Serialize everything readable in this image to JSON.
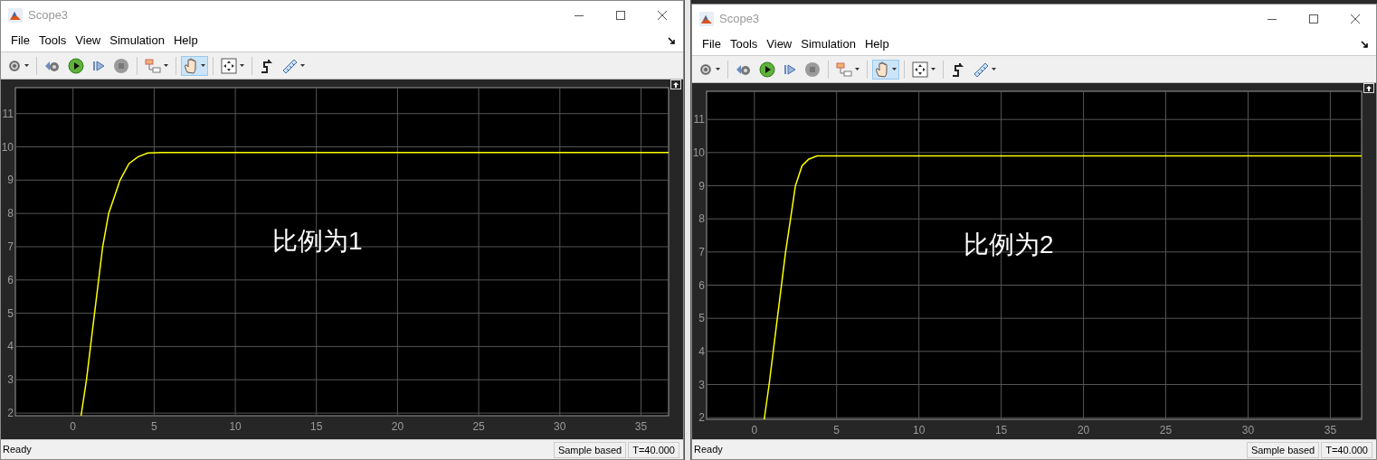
{
  "windows": [
    {
      "title": "Scope3",
      "menu": [
        {
          "label": "File"
        },
        {
          "label": "Tools"
        },
        {
          "label": "View"
        },
        {
          "label": "Simulation"
        },
        {
          "label": "Help"
        }
      ],
      "toolbar": {
        "pan_selected": true
      },
      "plot": {
        "overlay_text": "比例为1",
        "chart_data": {
          "type": "line",
          "grid": true,
          "x": [
            0.5,
            0.83,
            1.33,
            1.83,
            2.2,
            2.9,
            3.45,
            4.0,
            4.6,
            5.5,
            36.7
          ],
          "series": [
            {
              "color": "#ffff00",
              "values": [
                1.92,
                3,
                5,
                7,
                8,
                9,
                9.5,
                9.7,
                9.82,
                9.83,
                9.83
              ]
            }
          ],
          "xlim": [
            -3.55,
            36.7
          ],
          "ylim": [
            1.92,
            11.78
          ],
          "xticks": [
            0,
            5,
            10,
            15,
            20,
            25,
            30,
            35
          ],
          "yticks": [
            2,
            3,
            4,
            5,
            6,
            7,
            8,
            9,
            10,
            11
          ]
        }
      },
      "status": {
        "message": "Ready",
        "mode": "Sample based",
        "time": "T=40.000"
      }
    },
    {
      "title": "Scope3",
      "menu": [
        {
          "label": "File"
        },
        {
          "label": "Tools"
        },
        {
          "label": "View"
        },
        {
          "label": "Simulation"
        },
        {
          "label": "Help"
        }
      ],
      "toolbar": {
        "pan_selected": true
      },
      "plot": {
        "overlay_text": "比例为2",
        "chart_data": {
          "type": "line",
          "grid": true,
          "x": [
            0.6,
            0.9,
            1.4,
            1.9,
            2.2,
            2.5,
            2.9,
            3.3,
            3.8,
            36.9
          ],
          "series": [
            {
              "color": "#ffff00",
              "values": [
                1.95,
                3,
                5,
                7,
                8,
                9,
                9.6,
                9.8,
                9.9,
                9.9
              ]
            }
          ],
          "xlim": [
            -2.9,
            36.9
          ],
          "ylim": [
            1.95,
            11.85
          ],
          "xticks": [
            0,
            5,
            10,
            15,
            20,
            25,
            30,
            35
          ],
          "yticks": [
            2,
            3,
            4,
            5,
            6,
            7,
            8,
            9,
            10,
            11
          ]
        }
      },
      "status": {
        "message": "Ready",
        "mode": "Sample based",
        "time": "T=40.000"
      }
    }
  ]
}
